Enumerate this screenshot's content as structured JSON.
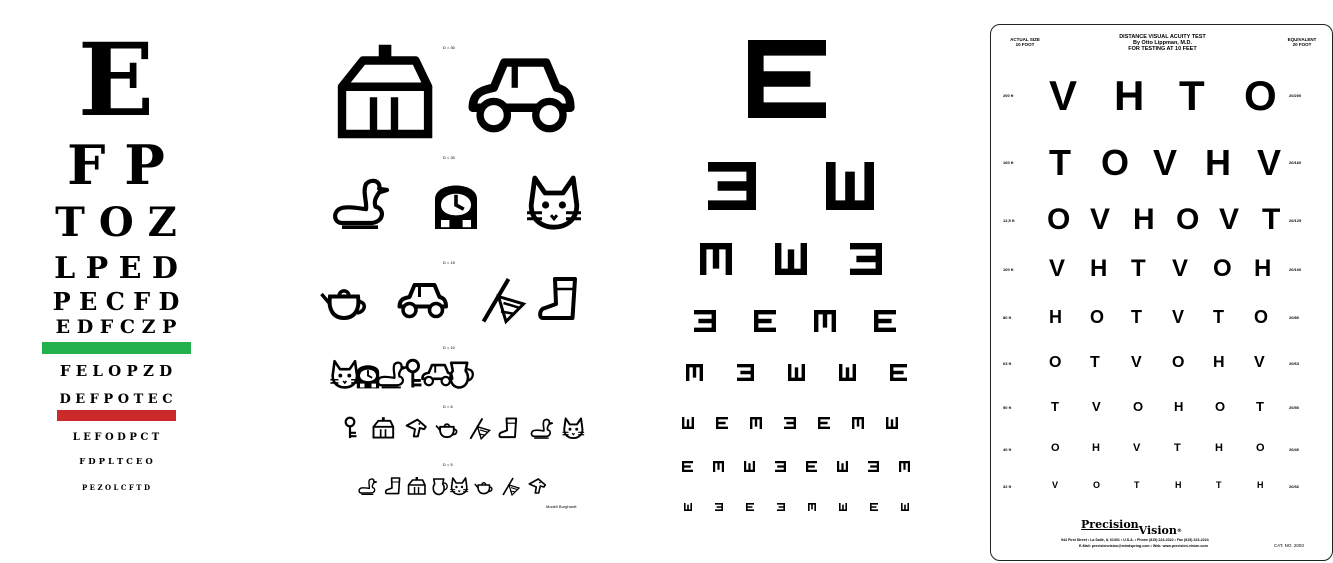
{
  "snellen": {
    "rows": [
      "E",
      "F P",
      "T O Z",
      "L P E D",
      "P E C F D",
      "E D F C Z P",
      "F E L O P Z D",
      "D E F P O T E C",
      "L E F O D P C T",
      "F D P L T C E O",
      "P E Z O L C F T D"
    ],
    "green_line_color": "#22b14c",
    "red_line_color": "#cc2a2a"
  },
  "pictures": {
    "row_labels": [
      "D = 30",
      "D = 30",
      "D = 15",
      "D = 10",
      "D = 6",
      "D = 5"
    ],
    "rows": [
      [
        "house-icon",
        "car-icon"
      ],
      [
        "duck-icon",
        "clock-icon",
        "cat-icon"
      ],
      [
        "teapot-icon",
        "car-icon",
        "flag-icon",
        "boot-icon"
      ],
      [
        "cat-icon",
        "clock-icon",
        "duck-icon",
        "key-icon",
        "car-icon",
        "jug-icon"
      ],
      [
        "key-icon",
        "house-icon",
        "horse-icon",
        "teapot-icon",
        "flag-icon",
        "boot-icon",
        "duck-icon",
        "cat-icon"
      ],
      [
        "duck-icon",
        "boot-icon",
        "house-icon",
        "jug-icon",
        "cat-icon",
        "teapot-icon",
        "flag-icon",
        "horse-icon"
      ]
    ],
    "footer": "Modell Burghardt"
  },
  "tumbling": {
    "rows": [
      [
        "right"
      ],
      [
        "left",
        "up"
      ],
      [
        "down",
        "up",
        "left"
      ],
      [
        "left",
        "right",
        "down",
        "right"
      ],
      [
        "down",
        "left",
        "up",
        "up",
        "right"
      ],
      [
        "up",
        "right",
        "down",
        "left",
        "right",
        "down",
        "up"
      ],
      [
        "right",
        "down",
        "up",
        "left",
        "right",
        "up",
        "left",
        "down"
      ],
      [
        "up",
        "left",
        "right",
        "left",
        "down",
        "up",
        "right",
        "up"
      ]
    ]
  },
  "hotv": {
    "header_left": [
      "ACTUAL SIZE",
      "10 FOOT"
    ],
    "header_center": [
      "DISTANCE VISUAL ACUITY TEST",
      "By Otto Lippman, M.D.",
      "FOR TESTING AT 10 FEET"
    ],
    "header_right": [
      "EQUIVALENT",
      "20 FOOT"
    ],
    "rows": [
      {
        "letters": [
          "V",
          "H",
          "T",
          "O"
        ],
        "left": "200 ft",
        "right": "20/200"
      },
      {
        "letters": [
          "T",
          "O",
          "V",
          "H",
          "V"
        ],
        "left": "160 ft",
        "right": "20/160"
      },
      {
        "letters": [
          "O",
          "V",
          "H",
          "O",
          "V",
          "T"
        ],
        "left": "12,5 ft",
        "right": "20/125"
      },
      {
        "letters": [
          "V",
          "H",
          "T",
          "V",
          "O",
          "H"
        ],
        "left": "100 ft",
        "right": "20/100"
      },
      {
        "letters": [
          "H",
          "O",
          "T",
          "V",
          "T",
          "O"
        ],
        "left": "80 ft",
        "right": "20/80"
      },
      {
        "letters": [
          "O",
          "T",
          "V",
          "O",
          "H",
          "V"
        ],
        "left": "63 ft",
        "right": "20/63"
      },
      {
        "letters": [
          "T",
          "V",
          "O",
          "H",
          "O",
          "T"
        ],
        "left": "50 ft",
        "right": "20/50"
      },
      {
        "letters": [
          "O",
          "H",
          "V",
          "T",
          "H",
          "O"
        ],
        "left": "40 ft",
        "right": "20/40"
      },
      {
        "letters": [
          "V",
          "O",
          "T",
          "H",
          "T",
          "H"
        ],
        "left": "32 ft",
        "right": "20/32"
      }
    ],
    "brand_a": "Precision",
    "brand_b": "Vision",
    "address": "944 First Street • La Salle, IL 61301 • U.S.A. • Phone (815) 223-2022 • Fax (815) 223-2224",
    "email": "E-Mail: precisionvision@mindspring.com • Web: www.precision-vision.com",
    "catalog": "CAT. NO. 2003"
  }
}
